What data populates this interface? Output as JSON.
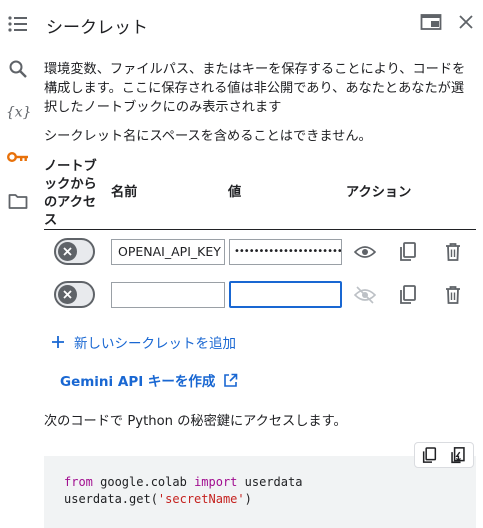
{
  "panel": {
    "title": "シークレット",
    "description": "環境変数、ファイルパス、またはキーを保存することにより、コードを構成します。ここに保存される値は非公開であり、あなたとあなたが選択したノートブックにのみ表示されます",
    "note": "シークレット名にスペースを含めることはできません。"
  },
  "table": {
    "headers": {
      "access": "ノートブックからのアクセス",
      "name": "名前",
      "value": "値",
      "actions": "アクション"
    },
    "rows": [
      {
        "access_enabled": false,
        "name": "OPENAI_API_KEY",
        "value": "••••••••••••••••••••••••••••••",
        "value_visible": false
      },
      {
        "access_enabled": false,
        "name": "",
        "value": "",
        "value_visible": false
      }
    ]
  },
  "add_secret_label": "新しいシークレットを追加",
  "gemini_link_label": "Gemini API キーを作成",
  "code_intro": "次のコードで Python の秘密鍵にアクセスします。",
  "code": {
    "line1": {
      "kw1": "from",
      "mod": " google.colab ",
      "kw2": "import",
      "name": " userdata"
    },
    "line2": {
      "pre": "userdata.get(",
      "str": "'secretName'",
      "post": ")"
    }
  },
  "colors": {
    "accent": "#1967d2",
    "key_icon": "#e8710a",
    "icon": "#5f6368"
  }
}
